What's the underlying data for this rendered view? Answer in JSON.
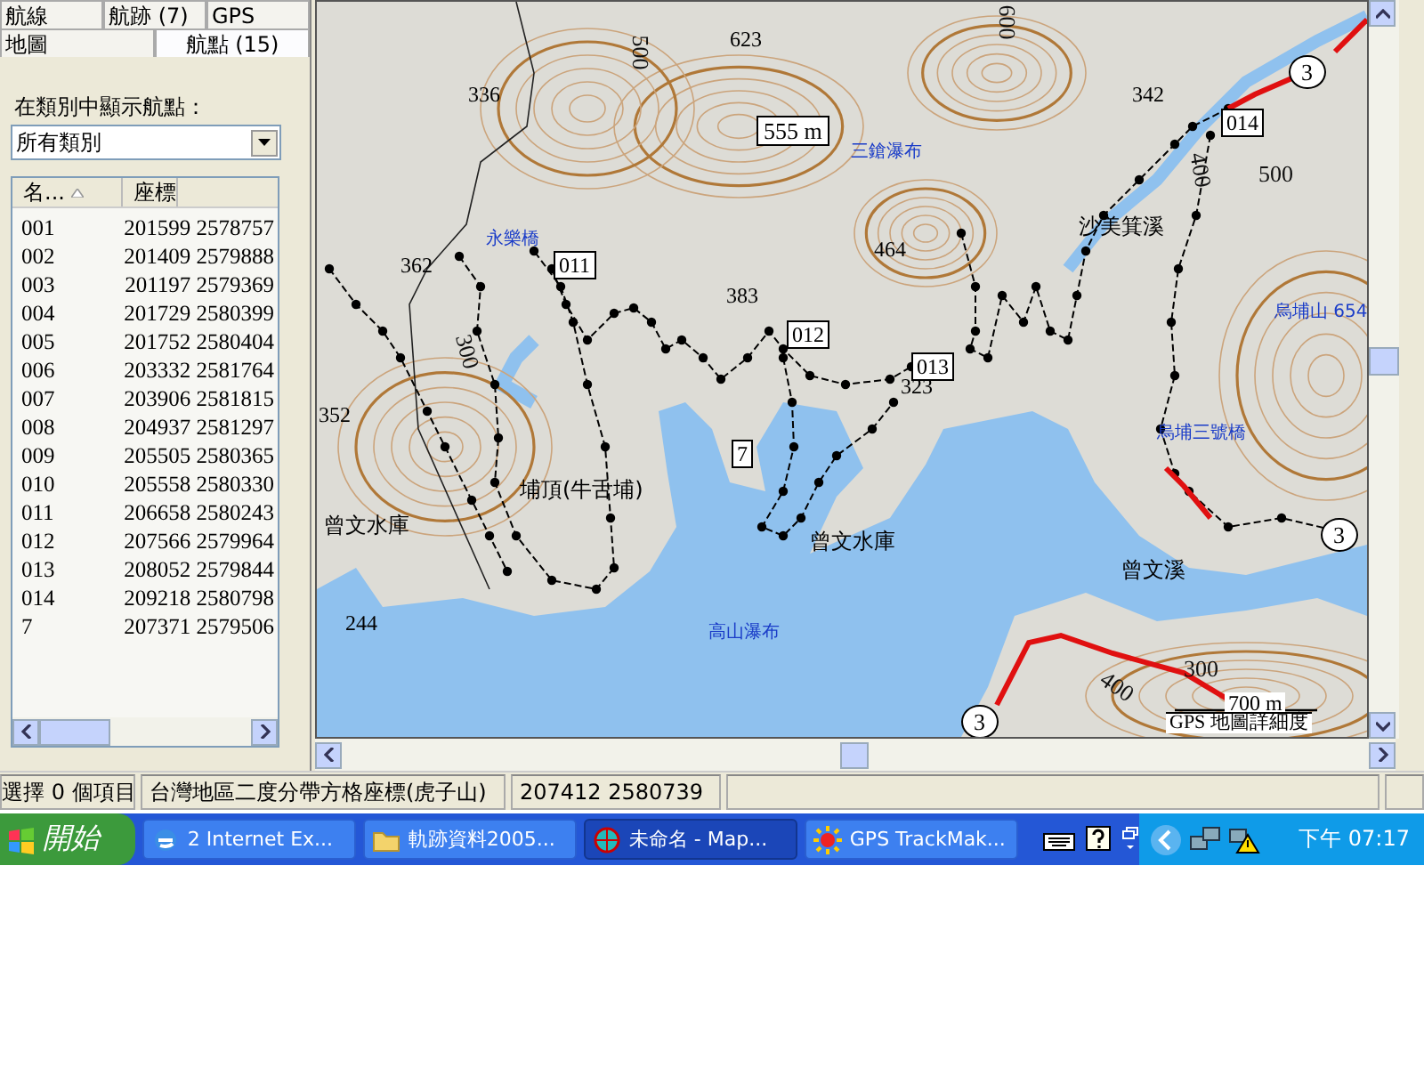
{
  "panel": {
    "tab_rows": [
      [
        {
          "label": "航線",
          "selected": false
        },
        {
          "label": "航跡 (7)",
          "selected": false
        },
        {
          "label": "GPS",
          "selected": false
        }
      ],
      [
        {
          "label": "地圖",
          "selected": false
        },
        {
          "label": "航點 (15)",
          "selected": true
        }
      ]
    ],
    "filter_label": "在類別中顯示航點：",
    "category_dropdown": {
      "value": "所有類別"
    },
    "waypoint_list": {
      "columns": [
        "名...",
        "座標"
      ],
      "rows": [
        {
          "name": "001",
          "coords": "201599 2578757"
        },
        {
          "name": "002",
          "coords": "201409 2579888"
        },
        {
          "name": "003",
          "coords": "201197 2579369"
        },
        {
          "name": "004",
          "coords": "201729 2580399"
        },
        {
          "name": "005",
          "coords": "201752 2580404"
        },
        {
          "name": "006",
          "coords": "203332 2581764"
        },
        {
          "name": "007",
          "coords": "203906 2581815"
        },
        {
          "name": "008",
          "coords": "204937 2581297"
        },
        {
          "name": "009",
          "coords": "205505 2580365"
        },
        {
          "name": "010",
          "coords": "205558 2580330"
        },
        {
          "name": "011",
          "coords": "206658 2580243"
        },
        {
          "name": "012",
          "coords": "207566 2579964"
        },
        {
          "name": "013",
          "coords": "208052 2579844"
        },
        {
          "name": "014",
          "coords": "209218 2580798"
        },
        {
          "name": "7",
          "coords": "207371 2579506"
        }
      ]
    }
  },
  "map": {
    "labels": [
      {
        "kind": "elevation",
        "text": "623"
      },
      {
        "kind": "contour",
        "text": "500"
      },
      {
        "kind": "contour",
        "text": "600"
      },
      {
        "kind": "elevation",
        "text": "336"
      },
      {
        "kind": "route",
        "text": "3"
      },
      {
        "kind": "measure",
        "text": "555 m"
      },
      {
        "kind": "elevation",
        "text": "342"
      },
      {
        "kind": "waypoint",
        "text": "014"
      },
      {
        "kind": "poi",
        "text": "三鎗瀑布"
      },
      {
        "kind": "contour",
        "text": "500"
      },
      {
        "kind": "contour",
        "text": "400"
      },
      {
        "kind": "place",
        "text": "沙美箕溪"
      },
      {
        "kind": "poi",
        "text": "永樂橋"
      },
      {
        "kind": "waypoint",
        "text": "011"
      },
      {
        "kind": "elevation",
        "text": "362"
      },
      {
        "kind": "elevation",
        "text": "464"
      },
      {
        "kind": "elevation",
        "text": "383"
      },
      {
        "kind": "poi",
        "text": "烏埔山 654"
      },
      {
        "kind": "waypoint",
        "text": "012"
      },
      {
        "kind": "waypoint",
        "text": "013"
      },
      {
        "kind": "contour",
        "text": "300"
      },
      {
        "kind": "elevation",
        "text": "323"
      },
      {
        "kind": "elevation",
        "text": "352"
      },
      {
        "kind": "waypoint",
        "text": "7"
      },
      {
        "kind": "poi",
        "text": "烏埔三號橋"
      },
      {
        "kind": "place",
        "text": "埔頂(牛舌埔)"
      },
      {
        "kind": "place",
        "text": "曾文水庫"
      },
      {
        "kind": "place",
        "text": "曾文水庫"
      },
      {
        "kind": "route",
        "text": "3"
      },
      {
        "kind": "place",
        "text": "曾文溪"
      },
      {
        "kind": "elevation",
        "text": "244"
      },
      {
        "kind": "poi",
        "text": "高山瀑布"
      },
      {
        "kind": "contour",
        "text": "300"
      },
      {
        "kind": "contour",
        "text": "400"
      },
      {
        "kind": "scale",
        "text": "700 m"
      },
      {
        "kind": "route",
        "text": "3"
      },
      {
        "kind": "detail",
        "text": "GPS 地圖詳細度"
      }
    ]
  },
  "status_bar": [
    "選擇 0 個項目",
    "台灣地區二度分帶方格座標(虎子山)",
    "207412 2580739"
  ],
  "taskbar": {
    "start": "開始",
    "buttons": [
      {
        "kind": "browser",
        "label": "2 Internet Ex...",
        "selected": false
      },
      {
        "kind": "folder",
        "label": "軌跡資料2005...",
        "selected": false
      },
      {
        "kind": "globe",
        "label": "未命名 - Map...",
        "selected": true
      },
      {
        "kind": "sun",
        "label": "GPS TrackMak...",
        "selected": false
      }
    ],
    "clock": "下午 07:17"
  }
}
